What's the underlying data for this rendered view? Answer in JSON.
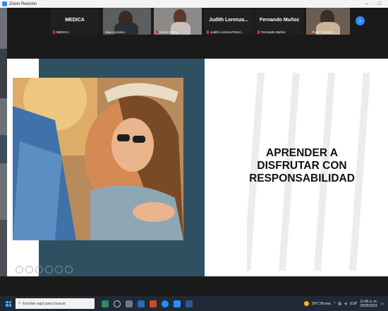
{
  "window": {
    "title": "Zoom Reunión",
    "minimize": "–",
    "restore": "□"
  },
  "gallery": {
    "tiles": [
      {
        "name": "MEDICA",
        "caption": "MEDICA",
        "video": false
      },
      {
        "name": "",
        "caption": "Alan Lezcano",
        "video": true
      },
      {
        "name": "",
        "caption": "Nicole Cerro",
        "video": true
      },
      {
        "name": "Judith  Lorenza...",
        "caption": "Judith Lorenza Pérez...",
        "video": false
      },
      {
        "name": "Fernando Muñoz",
        "caption": "Fernando Muñoz",
        "video": false
      },
      {
        "name": "",
        "caption": "Pablo Gallardo",
        "video": true
      }
    ],
    "next_icon": "chevron-right-icon"
  },
  "slide": {
    "headline_lines": [
      "APRENDER A",
      "DISFRUTAR CON",
      "RESPONSABILIDAD"
    ],
    "colors": {
      "panel": "#2f5061",
      "background": "#ffffff"
    }
  },
  "taskbar": {
    "search_placeholder": "Escribe aquí para buscar",
    "weather": "20ºC Bruma",
    "lang": "ESP",
    "time": "11:45 a. m.",
    "date": "25/05/2021"
  }
}
